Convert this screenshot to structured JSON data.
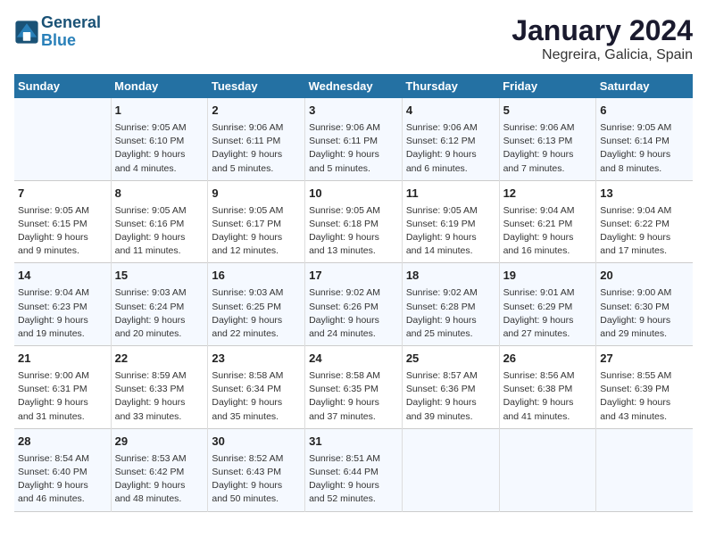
{
  "logo": {
    "line1": "General",
    "line2": "Blue"
  },
  "title": "January 2024",
  "subtitle": "Negreira, Galicia, Spain",
  "days_header": [
    "Sunday",
    "Monday",
    "Tuesday",
    "Wednesday",
    "Thursday",
    "Friday",
    "Saturday"
  ],
  "weeks": [
    [
      {
        "num": "",
        "info": ""
      },
      {
        "num": "1",
        "info": "Sunrise: 9:05 AM\nSunset: 6:10 PM\nDaylight: 9 hours\nand 4 minutes."
      },
      {
        "num": "2",
        "info": "Sunrise: 9:06 AM\nSunset: 6:11 PM\nDaylight: 9 hours\nand 5 minutes."
      },
      {
        "num": "3",
        "info": "Sunrise: 9:06 AM\nSunset: 6:11 PM\nDaylight: 9 hours\nand 5 minutes."
      },
      {
        "num": "4",
        "info": "Sunrise: 9:06 AM\nSunset: 6:12 PM\nDaylight: 9 hours\nand 6 minutes."
      },
      {
        "num": "5",
        "info": "Sunrise: 9:06 AM\nSunset: 6:13 PM\nDaylight: 9 hours\nand 7 minutes."
      },
      {
        "num": "6",
        "info": "Sunrise: 9:05 AM\nSunset: 6:14 PM\nDaylight: 9 hours\nand 8 minutes."
      }
    ],
    [
      {
        "num": "7",
        "info": "Sunrise: 9:05 AM\nSunset: 6:15 PM\nDaylight: 9 hours\nand 9 minutes."
      },
      {
        "num": "8",
        "info": "Sunrise: 9:05 AM\nSunset: 6:16 PM\nDaylight: 9 hours\nand 11 minutes."
      },
      {
        "num": "9",
        "info": "Sunrise: 9:05 AM\nSunset: 6:17 PM\nDaylight: 9 hours\nand 12 minutes."
      },
      {
        "num": "10",
        "info": "Sunrise: 9:05 AM\nSunset: 6:18 PM\nDaylight: 9 hours\nand 13 minutes."
      },
      {
        "num": "11",
        "info": "Sunrise: 9:05 AM\nSunset: 6:19 PM\nDaylight: 9 hours\nand 14 minutes."
      },
      {
        "num": "12",
        "info": "Sunrise: 9:04 AM\nSunset: 6:21 PM\nDaylight: 9 hours\nand 16 minutes."
      },
      {
        "num": "13",
        "info": "Sunrise: 9:04 AM\nSunset: 6:22 PM\nDaylight: 9 hours\nand 17 minutes."
      }
    ],
    [
      {
        "num": "14",
        "info": "Sunrise: 9:04 AM\nSunset: 6:23 PM\nDaylight: 9 hours\nand 19 minutes."
      },
      {
        "num": "15",
        "info": "Sunrise: 9:03 AM\nSunset: 6:24 PM\nDaylight: 9 hours\nand 20 minutes."
      },
      {
        "num": "16",
        "info": "Sunrise: 9:03 AM\nSunset: 6:25 PM\nDaylight: 9 hours\nand 22 minutes."
      },
      {
        "num": "17",
        "info": "Sunrise: 9:02 AM\nSunset: 6:26 PM\nDaylight: 9 hours\nand 24 minutes."
      },
      {
        "num": "18",
        "info": "Sunrise: 9:02 AM\nSunset: 6:28 PM\nDaylight: 9 hours\nand 25 minutes."
      },
      {
        "num": "19",
        "info": "Sunrise: 9:01 AM\nSunset: 6:29 PM\nDaylight: 9 hours\nand 27 minutes."
      },
      {
        "num": "20",
        "info": "Sunrise: 9:00 AM\nSunset: 6:30 PM\nDaylight: 9 hours\nand 29 minutes."
      }
    ],
    [
      {
        "num": "21",
        "info": "Sunrise: 9:00 AM\nSunset: 6:31 PM\nDaylight: 9 hours\nand 31 minutes."
      },
      {
        "num": "22",
        "info": "Sunrise: 8:59 AM\nSunset: 6:33 PM\nDaylight: 9 hours\nand 33 minutes."
      },
      {
        "num": "23",
        "info": "Sunrise: 8:58 AM\nSunset: 6:34 PM\nDaylight: 9 hours\nand 35 minutes."
      },
      {
        "num": "24",
        "info": "Sunrise: 8:58 AM\nSunset: 6:35 PM\nDaylight: 9 hours\nand 37 minutes."
      },
      {
        "num": "25",
        "info": "Sunrise: 8:57 AM\nSunset: 6:36 PM\nDaylight: 9 hours\nand 39 minutes."
      },
      {
        "num": "26",
        "info": "Sunrise: 8:56 AM\nSunset: 6:38 PM\nDaylight: 9 hours\nand 41 minutes."
      },
      {
        "num": "27",
        "info": "Sunrise: 8:55 AM\nSunset: 6:39 PM\nDaylight: 9 hours\nand 43 minutes."
      }
    ],
    [
      {
        "num": "28",
        "info": "Sunrise: 8:54 AM\nSunset: 6:40 PM\nDaylight: 9 hours\nand 46 minutes."
      },
      {
        "num": "29",
        "info": "Sunrise: 8:53 AM\nSunset: 6:42 PM\nDaylight: 9 hours\nand 48 minutes."
      },
      {
        "num": "30",
        "info": "Sunrise: 8:52 AM\nSunset: 6:43 PM\nDaylight: 9 hours\nand 50 minutes."
      },
      {
        "num": "31",
        "info": "Sunrise: 8:51 AM\nSunset: 6:44 PM\nDaylight: 9 hours\nand 52 minutes."
      },
      {
        "num": "",
        "info": ""
      },
      {
        "num": "",
        "info": ""
      },
      {
        "num": "",
        "info": ""
      }
    ]
  ]
}
